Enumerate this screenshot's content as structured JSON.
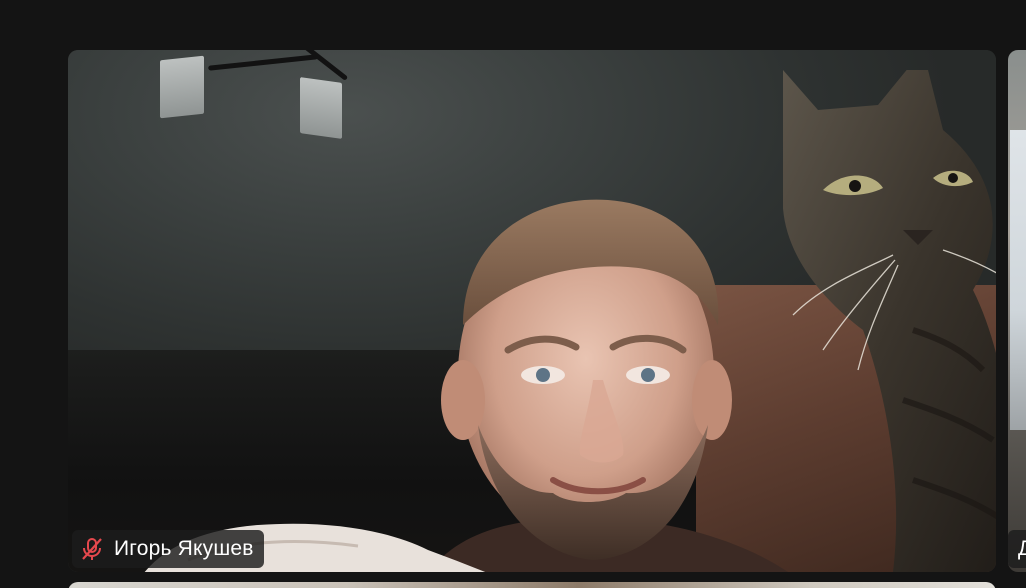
{
  "participant_main": {
    "name": "Игорь Якушев",
    "mic_state": "muted",
    "mic_icon": "mic-muted-icon",
    "muted_color": "#e5484d"
  },
  "participant_right": {
    "name_initial": "Д"
  },
  "colors": {
    "background": "#141414",
    "label_bg": "#1c1c1c",
    "label_text": "#ffffff"
  }
}
